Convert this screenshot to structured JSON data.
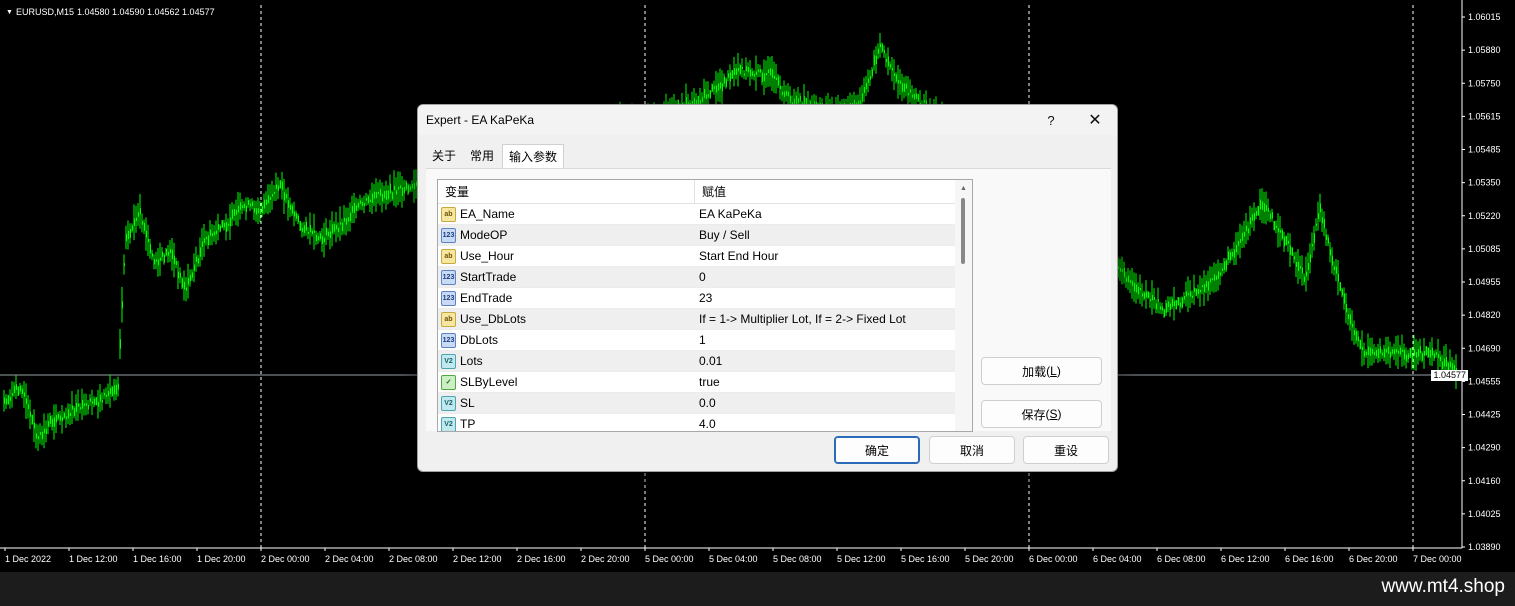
{
  "chart": {
    "symbol_info": "EURUSD,M15",
    "ohlc": "1.04580 1.04590 1.04562 1.04577",
    "current_price": "1.04577",
    "price_labels": [
      "1.06015",
      "1.05880",
      "1.05750",
      "1.05615",
      "1.05485",
      "1.05350",
      "1.05220",
      "1.05085",
      "1.04955",
      "1.04820",
      "1.04690",
      "1.04555",
      "1.04425",
      "1.04290",
      "1.04160",
      "1.04025",
      "1.03890"
    ],
    "time_labels": [
      "1 Dec 2022",
      "1 Dec 12:00",
      "1 Dec 16:00",
      "1 Dec 20:00",
      "2 Dec 00:00",
      "2 Dec 04:00",
      "2 Dec 08:00",
      "2 Dec 12:00",
      "2 Dec 16:00",
      "2 Dec 20:00",
      "5 Dec 00:00",
      "5 Dec 04:00",
      "5 Dec 08:00",
      "5 Dec 12:00",
      "5 Dec 16:00",
      "5 Dec 20:00",
      "6 Dec 00:00",
      "6 Dec 04:00",
      "6 Dec 08:00",
      "6 Dec 12:00",
      "6 Dec 16:00",
      "6 Dec 20:00",
      "7 Dec 00:00"
    ],
    "colors": {
      "candle": "#00ff00",
      "background": "#000000",
      "axis": "#ffffff",
      "separator": "#ffffff"
    }
  },
  "watermark": "www.mt4.shop",
  "dialog": {
    "title": "Expert - EA KaPeKa",
    "help_label": "?",
    "close_label": "✕",
    "tabs": [
      {
        "label": "关于",
        "active": false
      },
      {
        "label": "常用",
        "active": false
      },
      {
        "label": "输入参数",
        "active": true
      }
    ],
    "grid": {
      "col_name": "变量",
      "col_value": "赋值",
      "rows": [
        {
          "icon": "str",
          "icon_text": "ab",
          "name": "EA_Name",
          "value": "EA KaPeKa"
        },
        {
          "icon": "int",
          "icon_text": "123",
          "name": "ModeOP",
          "value": "Buy / Sell"
        },
        {
          "icon": "str",
          "icon_text": "ab",
          "name": "Use_Hour",
          "value": "Start End Hour"
        },
        {
          "icon": "int",
          "icon_text": "123",
          "name": "StartTrade",
          "value": "0"
        },
        {
          "icon": "int",
          "icon_text": "123",
          "name": "EndTrade",
          "value": "23"
        },
        {
          "icon": "str",
          "icon_text": "ab",
          "name": "Use_DbLots",
          "value": "If = 1-> Multiplier Lot, If = 2-> Fixed Lot"
        },
        {
          "icon": "int",
          "icon_text": "123",
          "name": "DbLots",
          "value": "1"
        },
        {
          "icon": "dbl",
          "icon_text": "V2",
          "name": "Lots",
          "value": "0.01"
        },
        {
          "icon": "bool",
          "icon_text": "✓",
          "name": "SLByLevel",
          "value": "true"
        },
        {
          "icon": "dbl",
          "icon_text": "V2",
          "name": "SL",
          "value": "0.0"
        },
        {
          "icon": "dbl",
          "icon_text": "V2",
          "name": "TP",
          "value": "4.0"
        }
      ]
    },
    "buttons": {
      "load": "加载",
      "load_key": "L",
      "save": "保存",
      "save_key": "S",
      "ok": "确定",
      "cancel": "取消",
      "reset": "重设"
    }
  }
}
